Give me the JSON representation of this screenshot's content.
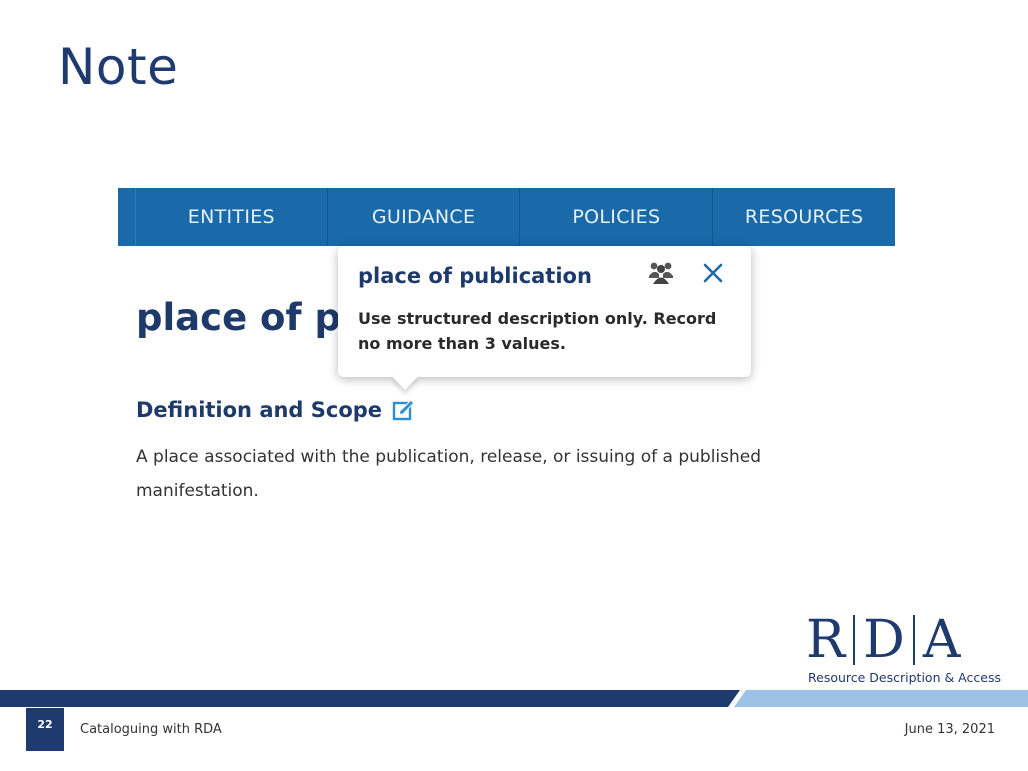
{
  "slide": {
    "title": "Note",
    "page_number": "22",
    "footer_left": "Cataloguing with RDA",
    "footer_right": "June 13, 2021"
  },
  "nav": {
    "items": [
      {
        "label": "ENTITIES"
      },
      {
        "label": "GUIDANCE"
      },
      {
        "label": "POLICIES"
      },
      {
        "label": "RESOURCES"
      }
    ]
  },
  "page": {
    "heading": "place of p"
  },
  "popover": {
    "title": "place of publication",
    "body": "Use structured description only. Record no more than 3 values.",
    "icons": {
      "group": "group-icon",
      "close": "close-icon"
    }
  },
  "section": {
    "heading": "Definition and Scope",
    "edit_icon": "edit-icon",
    "definition": "A place associated with the publication, release, or issuing of a published manifestation."
  },
  "logo": {
    "letters": [
      "R",
      "D",
      "A"
    ],
    "subtitle": "Resource Description & Access"
  },
  "colors": {
    "navbar": "#1a6aa9",
    "title": "#1f3a6e",
    "accent": "#2a8fd6"
  }
}
